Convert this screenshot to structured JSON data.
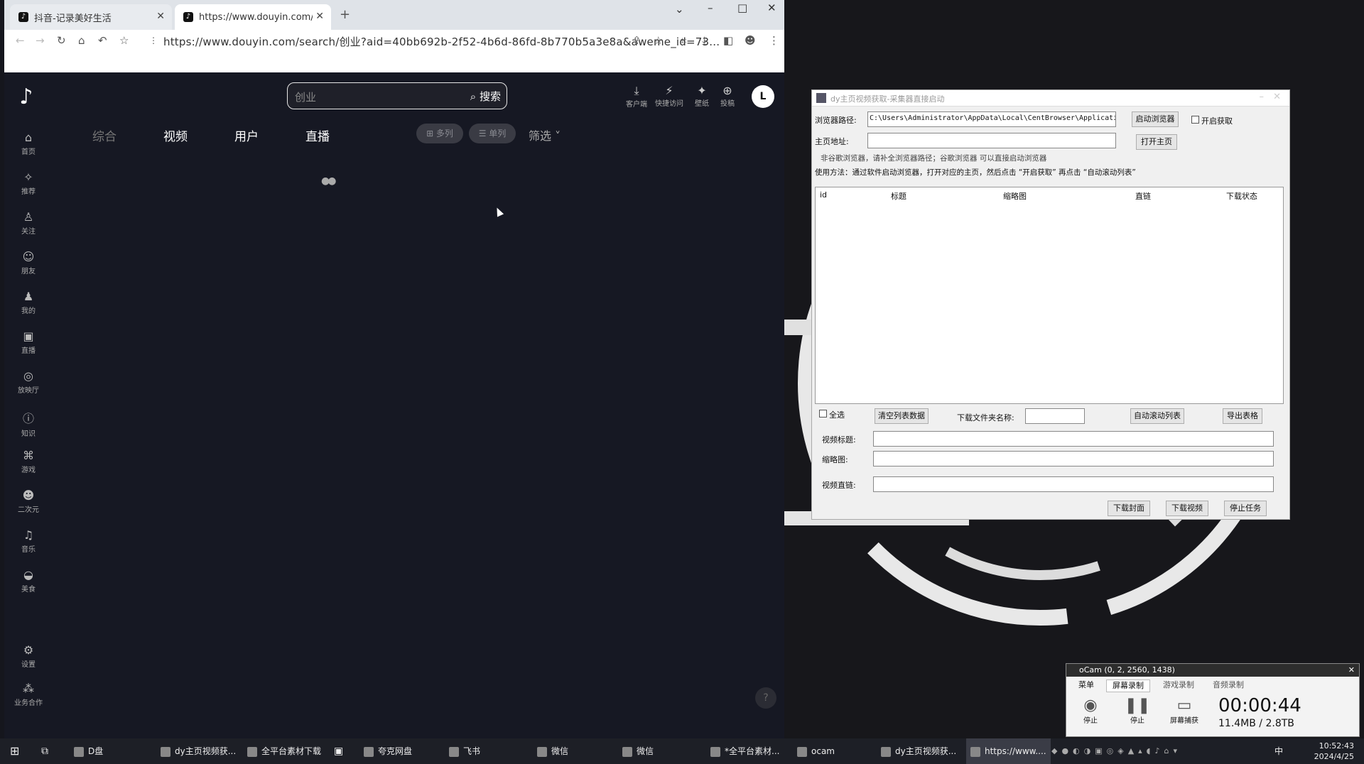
{
  "browser": {
    "tabs": [
      {
        "title": "抖音-记录美好生活",
        "active": false
      },
      {
        "title": "https://www.douyin.com/sea",
        "active": true
      }
    ],
    "new_tab": "+",
    "url": "https://www.douyin.com/search/创业?aid=40bb692b-2f52-4b6d-86fd-8b770b5a3e8a&aweme_id=73...",
    "window_controls": [
      "⌄",
      "–",
      "□",
      "✕"
    ]
  },
  "douyin": {
    "logo": "♪",
    "search": {
      "value": "创业",
      "button": "搜索"
    },
    "top_icons": [
      {
        "glyph": "⤓",
        "label": "客户端"
      },
      {
        "glyph": "⚡",
        "label": "快捷访问"
      },
      {
        "glyph": "✦",
        "label": "壁纸"
      },
      {
        "glyph": "⊕",
        "label": "投稿"
      }
    ],
    "avatar": "L",
    "sidebar": [
      {
        "glyph": "⌂",
        "label": "首页"
      },
      {
        "glyph": "✧",
        "label": "推荐"
      },
      {
        "glyph": "♙",
        "label": "关注"
      },
      {
        "glyph": "☺",
        "label": "朋友"
      },
      {
        "glyph": "♟",
        "label": "我的"
      },
      {
        "glyph": "▣",
        "label": "直播"
      },
      {
        "glyph": "◎",
        "label": "放映厅"
      },
      {
        "glyph": "ⓘ",
        "label": "知识"
      },
      {
        "glyph": "⌘",
        "label": "游戏"
      },
      {
        "glyph": "☻",
        "label": "二次元"
      },
      {
        "glyph": "♫",
        "label": "音乐"
      },
      {
        "glyph": "◒",
        "label": "美食"
      },
      {
        "glyph": "⚙",
        "label": "设置"
      },
      {
        "glyph": "⁂",
        "label": "业务合作"
      }
    ],
    "content_tabs": [
      "综合",
      "视频",
      "用户",
      "直播"
    ],
    "pills": [
      "⊞ 多列",
      "☰ 单列"
    ],
    "filter": "筛选 ˅",
    "help": "?"
  },
  "app": {
    "title": "dy主页视频获取-采集器直接启动",
    "browser_path_label": "浏览器路径:",
    "browser_path_value": "C:\\Users\\Administrator\\AppData\\Local\\CentBrowser\\Application\\",
    "launch_button": "启动浏览器",
    "enable_fetch": "开启获取",
    "home_label": "主页地址:",
    "home_value": "",
    "open_home_button": "打开主页",
    "hint1": "非谷歌浏览器，请补全浏览器路径；谷歌浏览器 可以直接启动浏览器",
    "hint2": "使用方法：通过软件启动浏览器，打开对应的主页，然后点击 “开启获取” 再点击 “自动滚动列表”",
    "columns": [
      "id",
      "标题",
      "缩略图",
      "直链",
      "下载状态"
    ],
    "select_all": "全选",
    "clear_button": "清空列表数据",
    "folder_label": "下载文件夹名称:",
    "folder_value": "",
    "auto_scroll_button": "自动滚动列表",
    "export_button": "导出表格",
    "video_title_label": "视频标题:",
    "thumb_label": "缩略图:",
    "direct_link_label": "视频直链:",
    "download_cover_button": "下载封面",
    "download_video_button": "下载视频",
    "stop_button": "停止任务"
  },
  "ocam": {
    "title": "oCam (0, 2, 2560, 1438)",
    "tabs": [
      "菜单",
      "屏幕录制",
      "游戏录制",
      "音频录制"
    ],
    "buttons": [
      "停止",
      "停止",
      "屏幕捕获"
    ],
    "time": "00:00:44",
    "size": "11.4MB / 2.8TB"
  },
  "taskbar": {
    "items": [
      "D盘",
      "dy主页视频获...",
      "全平台素材下载",
      "夸克网盘",
      "飞书",
      "微信",
      "微信",
      "*全平台素材...",
      "ocam",
      "dy主页视频获...",
      "https://www...."
    ],
    "time": "10:52:43",
    "date": "2024/4/25",
    "ime": "中"
  }
}
